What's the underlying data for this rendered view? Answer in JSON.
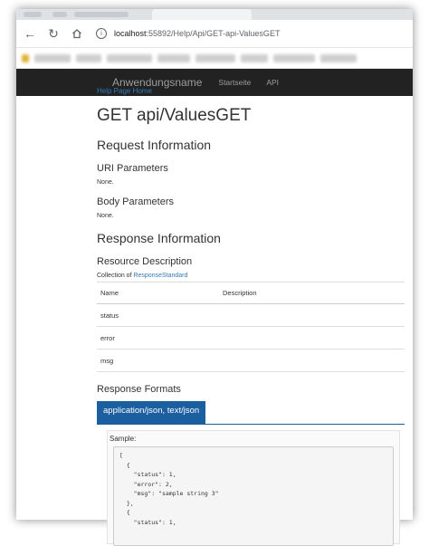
{
  "browser": {
    "address_host": "localhost",
    "address_path": ":55892/Help/Api/GET-api-ValuesGET"
  },
  "nav": {
    "brand": "Anwendungsname",
    "links": [
      "Startseite",
      "API"
    ]
  },
  "page": {
    "help_link": "Help Page Home",
    "title": "GET api/ValuesGET",
    "request_heading": "Request Information",
    "uri_params_heading": "URI Parameters",
    "uri_params_value": "None.",
    "body_params_heading": "Body Parameters",
    "body_params_value": "None.",
    "response_heading": "Response Information",
    "resource_desc_heading": "Resource Description",
    "collection_prefix": "Collection of ",
    "collection_link": "ResponseStandard",
    "table": {
      "headers": [
        "Name",
        "Description"
      ],
      "rows": [
        [
          "status",
          ""
        ],
        [
          "error",
          ""
        ],
        [
          "msg",
          ""
        ]
      ]
    },
    "formats_heading": "Response Formats",
    "format_tab": "application/json, text/json",
    "sample_label": "Sample:",
    "sample_code": "[\n  {\n    \"status\": 1,\n    \"error\": 2,\n    \"msg\": \"sample string 3\"\n  },\n  {\n    \"status\": 1,"
  }
}
